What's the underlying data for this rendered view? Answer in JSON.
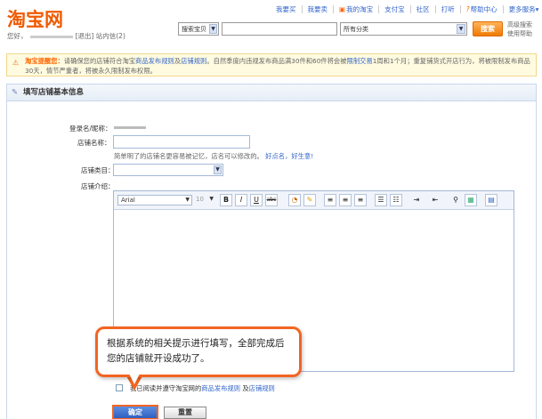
{
  "header": {
    "logo": "淘宝网",
    "greeting": "您好，",
    "logout": "[退出]",
    "messages": "站内信(2)"
  },
  "topnav": [
    {
      "label": "我要买",
      "icon": ""
    },
    {
      "label": "我要卖",
      "icon": ""
    },
    {
      "label": "我的淘宝",
      "icon": "cart-icon"
    },
    {
      "label": "支付宝",
      "icon": ""
    },
    {
      "label": "社区",
      "icon": ""
    },
    {
      "label": "打听",
      "icon": ""
    },
    {
      "label": "帮助中心",
      "icon": "help-icon"
    },
    {
      "label": "更多服务",
      "icon": ""
    }
  ],
  "search": {
    "type_selected": "搜索宝贝",
    "query": "",
    "category_selected": "所有分类",
    "button": "搜索",
    "advanced": "高级搜索",
    "usage": "使用帮助"
  },
  "notice": {
    "title": "淘宝提醒您：",
    "text1": "请确保您的店铺符合淘宝",
    "link1": "商品发布规则",
    "and": "及",
    "link2": "店铺规则",
    "text2": "。自然季度内违规发布商品满30件和60件将会被",
    "link3": "限制交易",
    "text3": "1周和1个月；重复铺货式开店行为，将被限制发布商品30天，情节严重者，将被永久限制发布权限。"
  },
  "panel": {
    "title": "填写店铺基本信息",
    "login_label": "登录名/昵称：",
    "shop_name_label": "店铺名称：",
    "shop_name_value": "",
    "shop_name_hint": "简单明了的店铺名更容易被记忆，店名可以修改的。",
    "hint_link1": "好点名，",
    "hint_link2": "好生意!",
    "category_label": "店铺类目：",
    "category_value": "",
    "intro_label": "店铺介绍："
  },
  "editor": {
    "font": "Arial",
    "size": "10",
    "buttons": [
      "B",
      "I",
      "U",
      "abc"
    ]
  },
  "agreement": {
    "checked": false,
    "text": "我已阅读并遵守淘宝网的",
    "link1": "商品发布规则",
    "and": "及",
    "link2": "店铺规则"
  },
  "actions": {
    "ok": "确定",
    "reset": "重置"
  },
  "tooltip": {
    "text": "根据系统的相关提示进行填写，全部完成后您的店铺就开设成功了。"
  },
  "colors": {
    "brand_orange": "#f05a00",
    "link_blue": "#3366cc",
    "highlight_orange": "#f26522"
  }
}
